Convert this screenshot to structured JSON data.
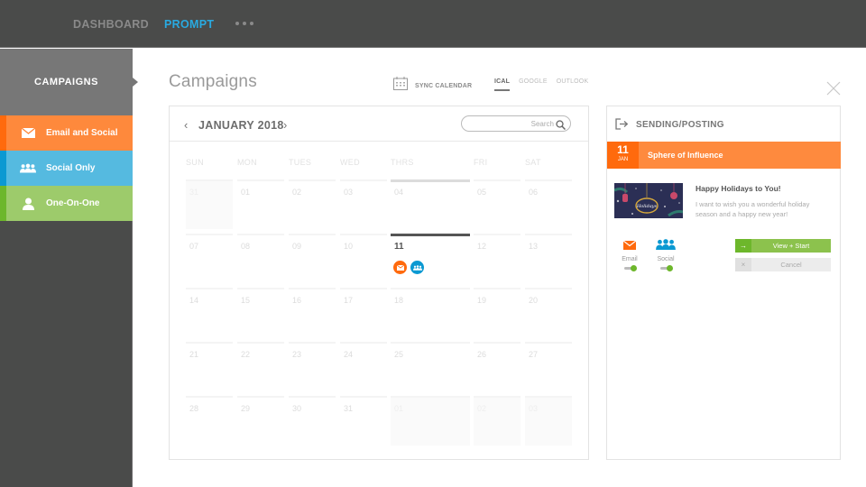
{
  "topnav": {
    "items": [
      {
        "label": "DASHBOARD",
        "active": false
      },
      {
        "label": "PROMPT",
        "active": true
      }
    ],
    "more_icon": "ellipsis-icon"
  },
  "sidebar": {
    "header": "CAMPAIGNS",
    "items": [
      {
        "label": "Email and Social",
        "icon": "envelope-icon",
        "color": "#fe893c",
        "accent": "#ff6a0d"
      },
      {
        "label": "Social Only",
        "icon": "group-icon",
        "color": "#55bae0",
        "accent": "#0b99d2"
      },
      {
        "label": "One-On-One",
        "icon": "user-icon",
        "color": "#9dcb6b",
        "accent": "#6db72b"
      }
    ]
  },
  "main": {
    "title": "Campaigns",
    "sync_label": "SYNC CALENDAR",
    "tabs": [
      {
        "label": "ICAL",
        "active": true
      },
      {
        "label": "GOOGLE",
        "active": false
      },
      {
        "label": "OUTLOOK",
        "active": false
      }
    ]
  },
  "calendar": {
    "month": "JANUARY 2018",
    "search_placeholder": "Search",
    "weekdays": [
      "SUN",
      "MON",
      "TUES",
      "WED",
      "THRS",
      "FRI",
      "SAT"
    ],
    "weeks": [
      [
        "31",
        "01",
        "02",
        "03",
        "04",
        "05",
        "06"
      ],
      [
        "07",
        "08",
        "09",
        "10",
        "11",
        "12",
        "13"
      ],
      [
        "14",
        "15",
        "16",
        "17",
        "18",
        "19",
        "20"
      ],
      [
        "21",
        "22",
        "23",
        "24",
        "25",
        "26",
        "27"
      ],
      [
        "28",
        "29",
        "30",
        "31",
        "01",
        "02",
        "03"
      ]
    ],
    "today": "11",
    "events_on_11": [
      {
        "type": "email",
        "icon": "envelope-icon",
        "color": "#ff6a0d"
      },
      {
        "type": "social",
        "icon": "group-icon",
        "color": "#0b99d2"
      }
    ]
  },
  "panel": {
    "title": "SENDING/POSTING",
    "event": {
      "day": "11",
      "month": "JAN",
      "name": "Sphere of Influence"
    },
    "message": {
      "title": "Happy Holidays to You!",
      "body": "I want to wish you a wonderful holiday season and a happy new year!"
    },
    "channels": [
      {
        "label": "Email",
        "enabled": true
      },
      {
        "label": "Social",
        "enabled": true
      }
    ],
    "start_label": "View + Start",
    "cancel_label": "Cancel"
  }
}
